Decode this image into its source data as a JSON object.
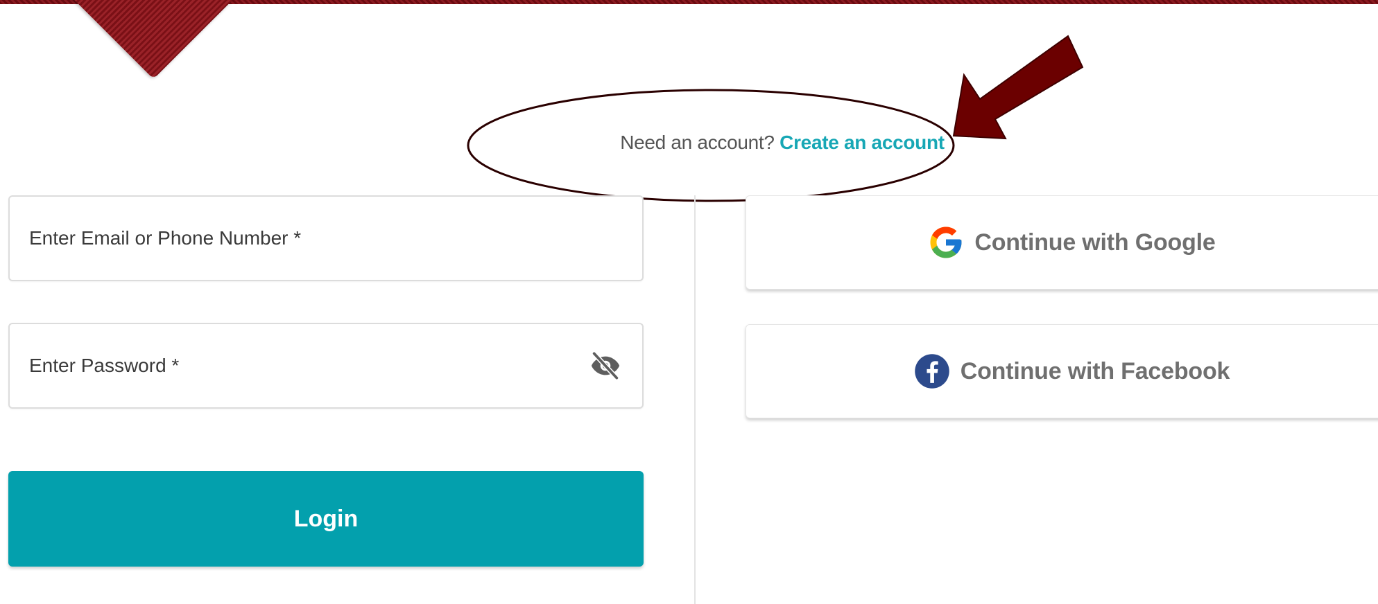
{
  "signup": {
    "prompt": "Need an account?",
    "link": "Create an account"
  },
  "login_form": {
    "email_placeholder": "Enter Email or Phone Number *",
    "password_placeholder": "Enter Password *",
    "password_toggle_icon": "eye-slash-icon",
    "login_label": "Login"
  },
  "social": {
    "google_label": "Continue with Google",
    "google_icon": "google-g-icon",
    "facebook_label": "Continue with Facebook",
    "facebook_icon": "facebook-f-icon"
  },
  "colors": {
    "accent_teal": "#03a0ad",
    "link_teal": "#17a7b5",
    "annotation_arrow": "#6b0000",
    "brand_maroon": "#7a1016",
    "facebook_blue": "#2c4a8c"
  },
  "annotation": {
    "ellipse": "outline-circle-around-signup",
    "arrow": "pointing-arrow"
  }
}
